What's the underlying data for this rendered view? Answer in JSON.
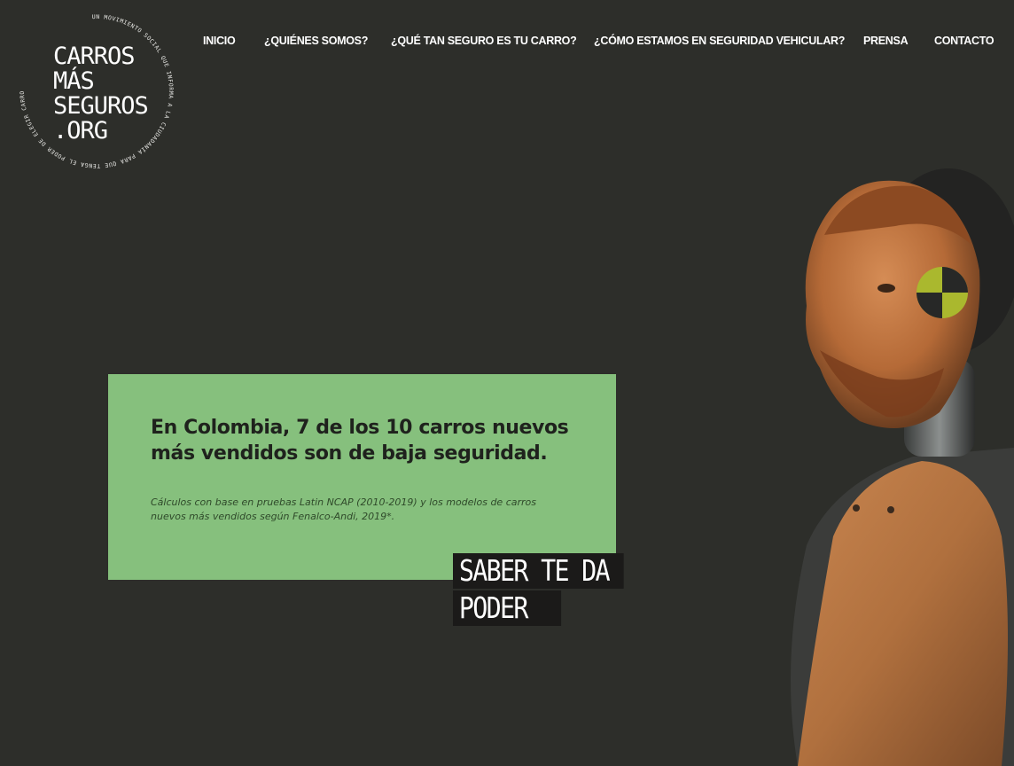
{
  "logo": {
    "lines": [
      "CARROS",
      "MÁS",
      "SEGUROS",
      ".ORG"
    ],
    "ring_text": "UN MOVIMIENTO SOCIAL QUE INFORMA A LA CIUDADANÍA PARA QUE TENGA EL PODER DE ELEGIR CARROS MÁS SEGUROS Y SALVAR VIDAS."
  },
  "nav": {
    "items": [
      {
        "label": "INICIO"
      },
      {
        "label": "¿QUIÉNES SOMOS?"
      },
      {
        "label": "¿QUÉ TAN SEGURO ES TU CARRO?"
      },
      {
        "label": "¿CÓMO ESTAMOS EN SEGURIDAD VEHICULAR?"
      },
      {
        "label": "PRENSA"
      },
      {
        "label": "CONTACTO"
      }
    ]
  },
  "hero": {
    "headline": "En Colombia, 7 de los 10 carros nuevos más vendidos son de baja seguridad.",
    "note": "Cálculos con base en pruebas Latin NCAP (2010-2019) y los modelos de carros nuevos más vendidos según Fenalco-Andi, 2019*.",
    "tagline_line1": "SABER TE DA",
    "tagline_line2": "PODER"
  },
  "colors": {
    "background": "#2d2e2a",
    "card": "#86c07d",
    "tagline_bg": "#1b1a19",
    "text_light": "#ffffff"
  }
}
